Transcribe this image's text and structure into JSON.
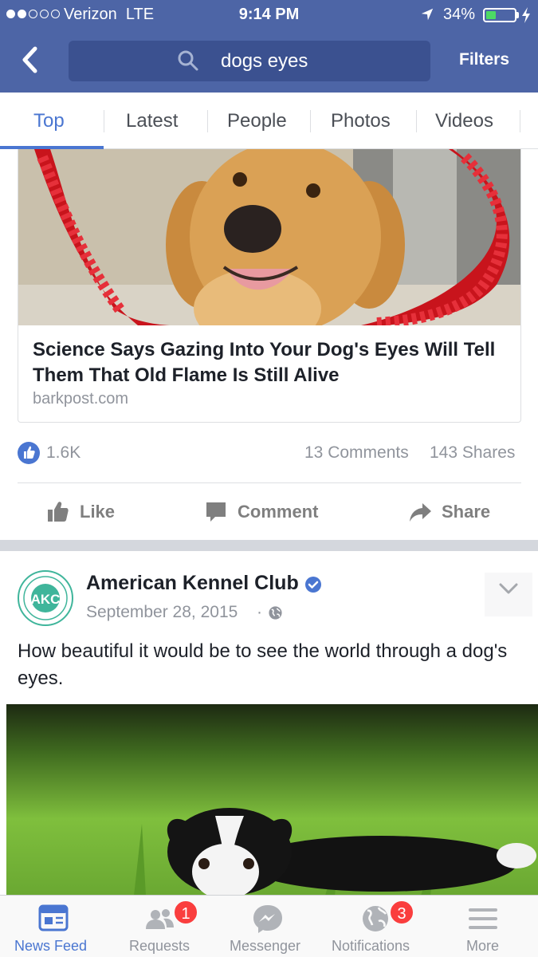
{
  "status_bar": {
    "carrier": "Verizon",
    "network": "LTE",
    "time": "9:14 PM",
    "battery_percent": "34%",
    "battery_level": 0.34,
    "signal_bars_filled": 2,
    "signal_bars_total": 5
  },
  "nav": {
    "back_icon": "back-chevron-icon",
    "search_icon": "search-icon",
    "search_query": "dogs eyes",
    "filters_label": "Filters"
  },
  "tabs": [
    {
      "label": "Top",
      "active": true
    },
    {
      "label": "Latest",
      "active": false
    },
    {
      "label": "People",
      "active": false
    },
    {
      "label": "Photos",
      "active": false
    },
    {
      "label": "Videos",
      "active": false
    }
  ],
  "link_post": {
    "title": "Science Says Gazing Into Your Dog's Eyes Will Tell Them That Old Flame Is Still Alive",
    "domain": "barkpost.com",
    "image": "golden-retriever-with-red-tinsel",
    "likes": "1.6K",
    "comments": "13 Comments",
    "shares": "143 Shares"
  },
  "actions": {
    "like": "Like",
    "comment": "Comment",
    "share": "Share"
  },
  "post2": {
    "page_name": "American Kennel Club",
    "avatar_text": "AKC",
    "date": "September 28, 2015",
    "separator": "·",
    "text": "How beautiful it would be to see the world through a dog's eyes.",
    "image": "border-collie-puppy-in-grass"
  },
  "tabbar": {
    "items": [
      {
        "label": "News Feed",
        "icon": "news-feed-icon",
        "active": true
      },
      {
        "label": "Requests",
        "icon": "friend-requests-icon",
        "badge": "1"
      },
      {
        "label": "Messenger",
        "icon": "messenger-icon"
      },
      {
        "label": "Notifications",
        "icon": "globe-icon",
        "badge": "3"
      },
      {
        "label": "More",
        "icon": "menu-icon"
      }
    ]
  },
  "colors": {
    "header": "#4d65a6",
    "search_box": "#3b5190",
    "accent": "#4a76d1",
    "badge": "#fa3e3e",
    "akc_green": "#3fb59b"
  }
}
